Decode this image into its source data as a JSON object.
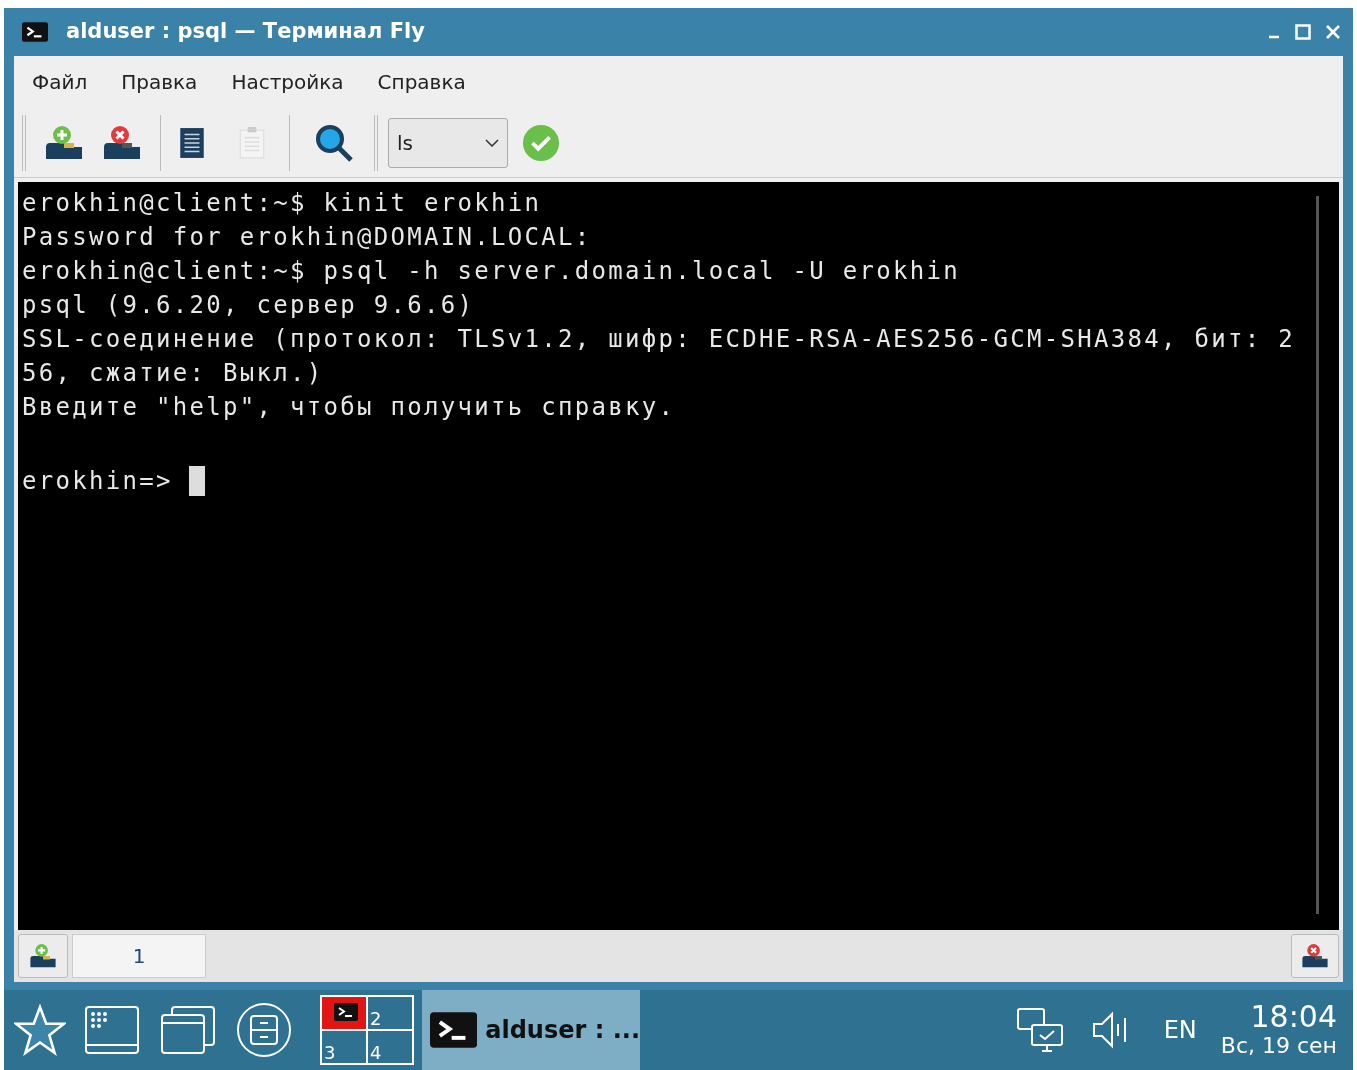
{
  "window": {
    "title": "alduser : psql — Терминал Fly"
  },
  "menu": [
    "Файл",
    "Правка",
    "Настройка",
    "Справка"
  ],
  "toolbar": {
    "command_combo": {
      "value": "ls"
    }
  },
  "terminal": {
    "lines": [
      "erokhin@client:~$ kinit erokhin",
      "Password for erokhin@DOMAIN.LOCAL:",
      "erokhin@client:~$ psql -h server.domain.local -U erokhin",
      "psql (9.6.20, сервер 9.6.6)",
      "SSL-соединение (протокол: TLSv1.2, шифр: ECDHE-RSA-AES256-GCM-SHA384, бит: 2",
      "56, сжатие: Выкл.)",
      "Введите \"help\", чтобы получить справку."
    ],
    "prompt": "erokhin=>"
  },
  "tabs": [
    {
      "label": "1",
      "selected": true
    }
  ],
  "taskbar": {
    "desktops": [
      {
        "selected": true
      },
      {
        "label": "2",
        "selected": false
      },
      {
        "label": "3",
        "selected": false
      },
      {
        "label": "4",
        "selected": false
      }
    ],
    "task": "alduser : ...",
    "language": "EN",
    "time": "18:04",
    "date": "Вс, 19 сен"
  }
}
